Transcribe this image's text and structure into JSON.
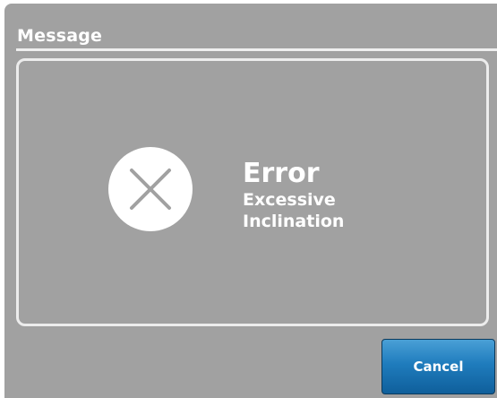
{
  "dialog": {
    "title": "Message",
    "icon": "error-x-icon",
    "message_title": "Error",
    "message_detail": "Excessive Inclination",
    "cancel_label": "Cancel"
  },
  "colors": {
    "dialog_background": "#a1a1a1",
    "text": "#ffffff",
    "button_top": "#4aa0d6",
    "button_bottom": "#0f5f9b"
  }
}
